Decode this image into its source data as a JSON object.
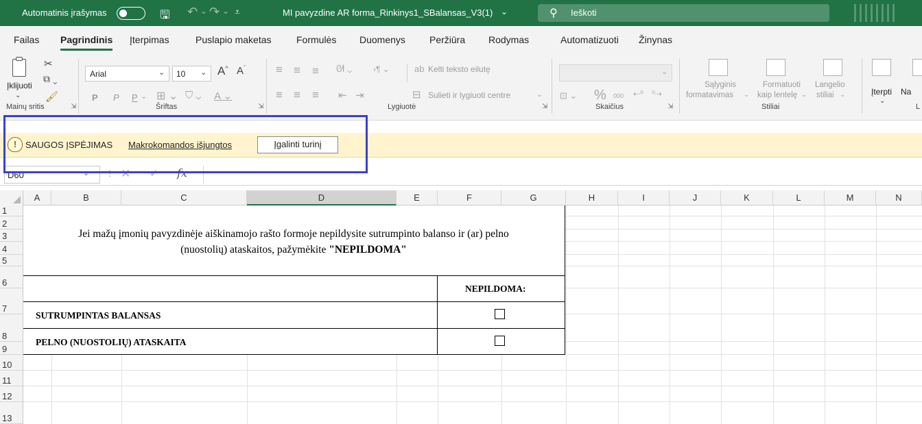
{
  "titlebar": {
    "autosave_label": "Automatinis įrašymas",
    "filename": "MI pavyzdine AR forma_Rinkinys1_SBalansas_V3(1)",
    "search_placeholder": "Ieškoti",
    "accent": "#217346"
  },
  "tabs": [
    "Failas",
    "Pagrindinis",
    "Įterpimas",
    "Puslapio maketas",
    "Formulės",
    "Duomenys",
    "Peržiūra",
    "Rodymas",
    "Automatizuoti",
    "Žinynas"
  ],
  "active_tab": "Pagrindinis",
  "ribbon": {
    "clipboard": {
      "paste_label": "Įklijuoti",
      "group_label": "Mainų sritis"
    },
    "font": {
      "font_name": "Arial",
      "font_size": "10",
      "bold": "P",
      "italic": "P",
      "underline": "P",
      "group_label": "Šriftas"
    },
    "alignment": {
      "wrap_text": "Kelti teksto eilutę",
      "merge_center": "Sulieti ir lygiuoti centre",
      "group_label": "Lygiuotė"
    },
    "number": {
      "group_label": "Skaičius",
      "percent": "%",
      "thousands": "000"
    },
    "styles": {
      "conditional": "Sąlyginis\nformatavimas",
      "conditional_l1": "Sąlyginis",
      "conditional_l2": "formatavimas",
      "format_table_l1": "Formatuoti",
      "format_table_l2": "kaip lentelę",
      "cell_styles_l1": "Langelio",
      "cell_styles_l2": "stiliai",
      "group_label": "Stiliai"
    },
    "cells": {
      "insert": "Įterpti",
      "partial": "Na"
    }
  },
  "security_bar": {
    "title": "SAUGOS ĮSPĖJIMAS",
    "message": "Makrokomandos išjungtos",
    "button": "Įgalinti turinį",
    "background": "#fff4ce",
    "highlight_color": "#3b3fd1"
  },
  "formula_bar": {
    "name_box": "D60",
    "fx": "fx"
  },
  "grid": {
    "columns": [
      "A",
      "B",
      "C",
      "D",
      "E",
      "F",
      "G",
      "H",
      "I",
      "J",
      "K",
      "L",
      "M",
      "N"
    ],
    "selected_column": "D",
    "rows": [
      "1",
      "2",
      "3",
      "4",
      "5",
      "6",
      "7",
      "8",
      "9",
      "10",
      "11",
      "12",
      "13"
    ]
  },
  "sheet": {
    "intro_line1": "Jei mažų įmonių pavyzdinėje aiškinamojo rašto formoje nepildysite sutrumpinto balanso ir (ar) pelno",
    "intro_line2_prefix": "(nuostolių) ataskaitos, pažymėkite ",
    "intro_line2_bold": "\"NEPILDOMA\"",
    "header": "NEPILDOMA:",
    "row7_label": "SUTRUMPINTAS BALANSAS",
    "row8_label": "PELNO (NUOSTOLIŲ) ATASKAITA"
  }
}
